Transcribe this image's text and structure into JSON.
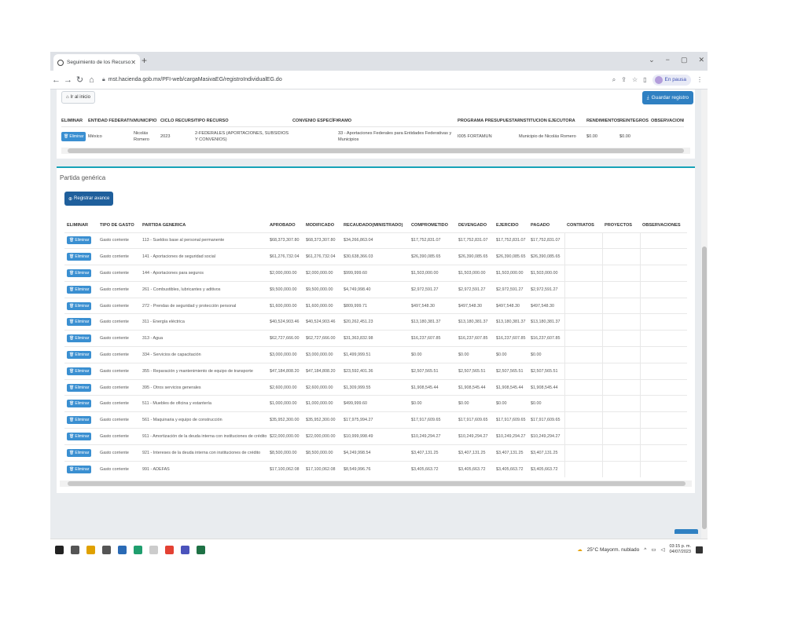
{
  "browser": {
    "tab_title": "Seguimiento de los Recursos Fe",
    "url": "mst.hacienda.gob.mx/PFI-web/cargaMasivaEG/registroIndividualEG.do",
    "profile_status": "En pausa"
  },
  "header": {
    "inicio_label": "Ir al inicio",
    "guardar_label": "Guardar registro"
  },
  "top_table": {
    "columns": [
      "ELIMINAR",
      "ENTIDAD FEDERATIVA",
      "MUNICIPIO",
      "CICLO RECURSO",
      "TIPO RECURSO",
      "CONVENIO ESPECÍFICO",
      "RAMO",
      "PROGRAMA PRESUPUESTARIO",
      "INSTITUCION EJECUTORA",
      "RENDIMIENTOS",
      "REINTEGROS",
      "OBSERVACIONES"
    ],
    "row": [
      "Eliminar",
      "México",
      "Nicolás Romero",
      "2023",
      "2-FEDERALES (APORTACIONES, SUBSIDIOS Y CONVENIOS)",
      "",
      "33 - Aportaciones Federales para Entidades Federativas y Municipios",
      "I005 FORTAMUN",
      "Municipio de Nicolás Romero",
      "$0.00",
      "$0.00",
      ""
    ]
  },
  "partida": {
    "title": "Partida genérica",
    "registrar_label": "Registrar avance",
    "columns": [
      "ELIMINAR",
      "TIPO DE GASTO",
      "PARTIDA GENERICA",
      "APROBADO",
      "MODIFICADO",
      "RECAUDADO(MINISTRADO)",
      "COMPROMETIDO",
      "DEVENGADO",
      "EJERCIDO",
      "PAGADO",
      "CONTRATOS",
      "PROYECTOS",
      "OBSERVACIONES"
    ],
    "delete_label": "Eliminar",
    "rows": [
      [
        "Gasto corriente",
        "113 - Sueldos base al personal permanente",
        "$68,373,307.80",
        "$68,373,307.80",
        "$34,266,863.04",
        "$17,752,831.07",
        "$17,752,831.07",
        "$17,752,831.07",
        "$17,752,831.07"
      ],
      [
        "Gasto corriente",
        "141 - Aportaciones de seguridad social",
        "$61,276,732.04",
        "$61,276,732.04",
        "$30,638,366.03",
        "$26,390,085.65",
        "$26,390,085.65",
        "$26,390,085.65",
        "$26,390,085.65"
      ],
      [
        "Gasto corriente",
        "144 - Aportaciones para seguros",
        "$2,000,000.00",
        "$2,000,000.00",
        "$999,999.60",
        "$1,503,000.00",
        "$1,503,000.00",
        "$1,503,000.00",
        "$1,503,000.00"
      ],
      [
        "Gasto corriente",
        "261 - Combustibles, lubricantes y aditivos",
        "$9,500,000.00",
        "$9,500,000.00",
        "$4,749,998.40",
        "$2,972,591.27",
        "$2,972,591.27",
        "$2,972,591.27",
        "$2,972,591.27"
      ],
      [
        "Gasto corriente",
        "272 - Prendas de seguridad y protección personal",
        "$1,600,000.00",
        "$1,600,000.00",
        "$809,999.71",
        "$497,548.30",
        "$497,548.30",
        "$497,548.30",
        "$497,548.30"
      ],
      [
        "Gasto corriente",
        "311 - Energía eléctrica",
        "$40,524,903.46",
        "$40,524,903.46",
        "$20,262,451.23",
        "$13,180,381.37",
        "$13,180,381.37",
        "$13,180,381.37",
        "$13,180,381.37"
      ],
      [
        "Gasto corriente",
        "313 - Agua",
        "$62,727,666.00",
        "$62,727,666.00",
        "$31,363,832.98",
        "$16,237,607.85",
        "$16,237,607.85",
        "$16,237,607.85",
        "$16,237,607.85"
      ],
      [
        "Gasto corriente",
        "334 - Servicios de capacitación",
        "$3,000,000.00",
        "$3,000,000.00",
        "$1,499,999.51",
        "$0.00",
        "$0.00",
        "$0.00",
        "$0.00"
      ],
      [
        "Gasto corriente",
        "355 - Reparación y mantenimiento de equipo de transporte",
        "$47,184,808.20",
        "$47,184,808.20",
        "$23,592,401.36",
        "$2,507,565.51",
        "$2,507,565.51",
        "$2,507,565.51",
        "$2,507,565.51"
      ],
      [
        "Gasto corriente",
        "395 - Otros servicios generales",
        "$2,600,000.00",
        "$2,600,000.00",
        "$1,309,999.55",
        "$1,908,545.44",
        "$1,908,545.44",
        "$1,908,545.44",
        "$1,908,545.44"
      ],
      [
        "Gasto corriente",
        "511 - Muebles de oficina y estantería",
        "$1,000,000.00",
        "$1,000,000.00",
        "$499,999.60",
        "$0.00",
        "$0.00",
        "$0.00",
        "$0.00"
      ],
      [
        "Gasto corriente",
        "561 - Maquinaria y equipo de construcción",
        "$35,952,300.00",
        "$35,952,300.00",
        "$17,975,994.27",
        "$17,917,609.65",
        "$17,917,609.65",
        "$17,917,609.65",
        "$17,917,609.65"
      ],
      [
        "Gasto corriente",
        "911 - Amortización de la deuda interna con instituciones de crédito",
        "$22,000,000.00",
        "$22,000,000.00",
        "$10,999,998.49",
        "$10,249,294.27",
        "$10,249,294.27",
        "$10,249,294.27",
        "$10,249,294.27"
      ],
      [
        "Gasto corriente",
        "921 - Intereses de la deuda interna con instituciones de crédito",
        "$8,500,000.00",
        "$8,500,000.00",
        "$4,249,998.54",
        "$3,407,131.25",
        "$3,407,131.25",
        "$3,407,131.25",
        "$3,407,131.25"
      ],
      [
        "Gasto corriente",
        "991 - ADEFAS",
        "$17,100,062.08",
        "$17,100,062.08",
        "$8,549,996.76",
        "$3,405,663.72",
        "$3,405,663.72",
        "$3,405,663.72",
        "$3,405,663.72"
      ]
    ]
  },
  "taskbar": {
    "weather": "25°C Mayorm. nublado",
    "time": "03:15 p. m.",
    "date": "04/07/2023",
    "icons": [
      "start-icon",
      "search-icon",
      "file-explorer-icon",
      "calculator-icon",
      "outlook-icon",
      "edge-icon",
      "notepad-icon",
      "chrome-icon",
      "teams-icon",
      "excel-icon"
    ]
  }
}
